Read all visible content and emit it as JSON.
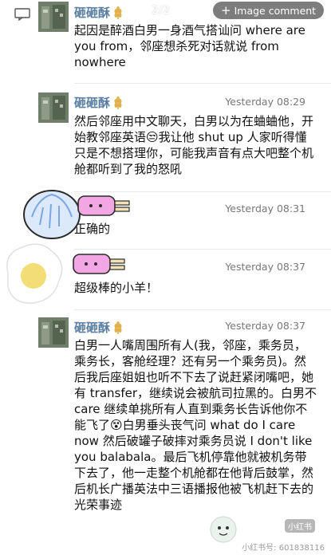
{
  "header": {
    "page_indicator": "2/2",
    "image_comment_label": "Image comment",
    "plus_icon": "plus-icon",
    "comment_icon": "comment-icon"
  },
  "messages": [
    {
      "name": "砸砸酥",
      "timestamp": "",
      "text": "起因是醉酒白男一身酒气搭讪问 where are you from，邻座想杀死对话就说 from nowhere"
    },
    {
      "name": "砸砸酥",
      "timestamp": "Yesterday 08:29",
      "text": "然后邻座用中文聊天，白男以为在蛐蛐他，开始教邻座英语😒我让他 shut up 人家听得懂只是不想搭理你，可能我声音有点大吧整个机舱都听到了我的怒吼"
    },
    {
      "name": "",
      "timestamp": "Yesterday 08:31",
      "text": "正确的"
    },
    {
      "name": "",
      "timestamp": "Yesterday 08:37",
      "text": "超级棒的小羊！"
    },
    {
      "name": "砸砸酥",
      "timestamp": "Yesterday 08:37",
      "text": "白男一人嘴周围所有人(我，邻座，乘务员，乘务长，客舱经理？还有另一个乘务员)。然后我后座姐姐也听不下去了说赶紧闭嘴吧，她有 transfer，继续说会被航司拉黑的。白男不 care 继续单挑所有人直到乘务长告诉他你不能飞了😵白男垂头丧气问 what do I care now 然后破罐子破摔对乘务员说 I don't like you balabala。最后飞机停靠他就被机务带下去了，他一走整个机舱都在他背后鼓掌，然后机长广播英法中三语播报他被飞机赶下去的光荣事迹"
    }
  ],
  "footer": {
    "brand": "小红书",
    "watermark": "小红书号: 601838116"
  },
  "colors": {
    "name": "#5b7fa3",
    "timestamp": "#777777",
    "pill_bg": "#7d7d7d"
  }
}
